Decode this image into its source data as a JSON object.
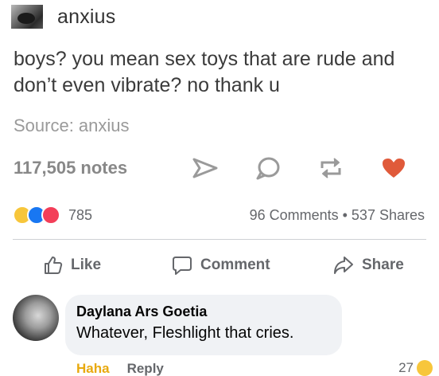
{
  "tumblr": {
    "username": "anxius",
    "post_text": "boys? you mean sex toys that are rude and don’t even vibrate? no thank u",
    "source": "Source: anxius",
    "notes": "117,505 notes",
    "icons": [
      "share-arrow-icon",
      "reply-bubble-icon",
      "reblog-icon",
      "heart-icon"
    ],
    "heart_color": "#e05a3a"
  },
  "facebook": {
    "reaction_icons": [
      "haha-reaction-icon",
      "like-reaction-icon",
      "love-reaction-icon"
    ],
    "reaction_count": "785",
    "counts": "96 Comments • 537 Shares",
    "actions": {
      "like": "Like",
      "comment": "Comment",
      "share": "Share"
    }
  },
  "comment": {
    "author": "Daylana Ars Goetia",
    "text": "Whatever, Fleshlight that cries.",
    "haha_label": "Haha",
    "reply_label": "Reply",
    "reaction_count": "27"
  }
}
